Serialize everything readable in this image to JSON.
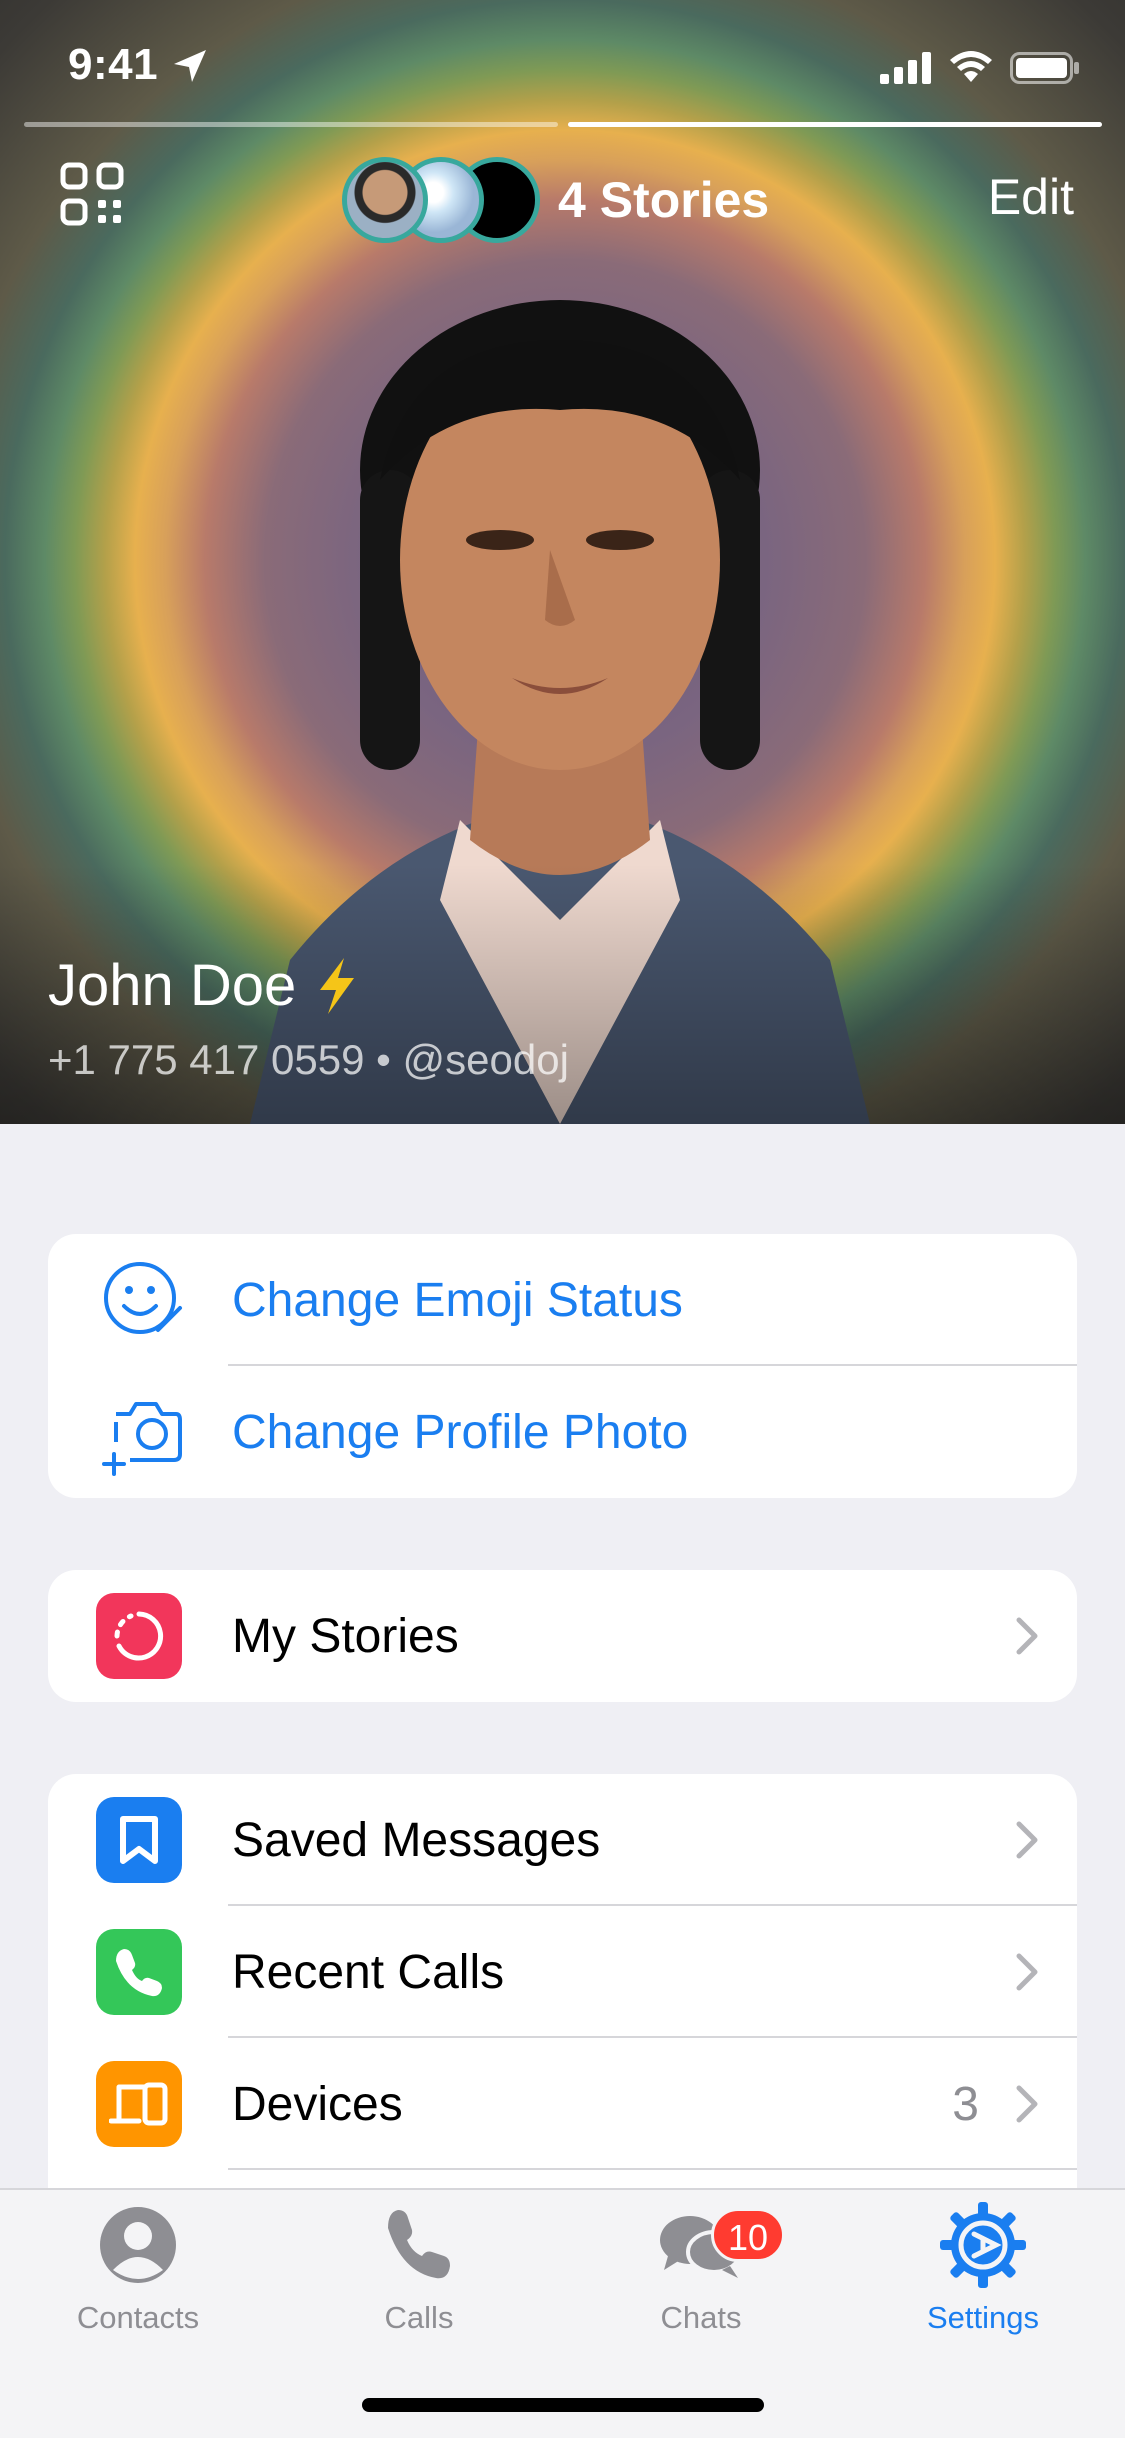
{
  "status_bar": {
    "time": "9:41"
  },
  "header": {
    "stories_label": "4 Stories",
    "edit_label": "Edit"
  },
  "profile": {
    "name": "John Doe",
    "phone_username": "+1 775 417 0559 • @seodoj"
  },
  "actions": [
    {
      "label": "Change Emoji Status",
      "icon": "emoji-status-icon"
    },
    {
      "label": "Change Profile Photo",
      "icon": "camera-add-icon"
    }
  ],
  "stories_section": {
    "label": "My Stories",
    "icon": "stories-icon",
    "color": "#f2365b"
  },
  "menu": [
    {
      "label": "Saved Messages",
      "icon": "bookmark-icon",
      "color": "#1a7ef0"
    },
    {
      "label": "Recent Calls",
      "icon": "phone-icon",
      "color": "#34c759"
    },
    {
      "label": "Devices",
      "icon": "devices-icon",
      "color": "#ff9500",
      "value": "3"
    }
  ],
  "tabbar": {
    "tabs": [
      {
        "label": "Contacts",
        "icon": "person-circle-icon"
      },
      {
        "label": "Calls",
        "icon": "phone-icon"
      },
      {
        "label": "Chats",
        "icon": "chat-bubbles-icon",
        "badge": "10"
      },
      {
        "label": "Settings",
        "icon": "gear-icon",
        "active": true
      }
    ]
  },
  "colors": {
    "accent": "#1a7ef0",
    "background": "#efeff4",
    "badge": "#ff3b30"
  }
}
